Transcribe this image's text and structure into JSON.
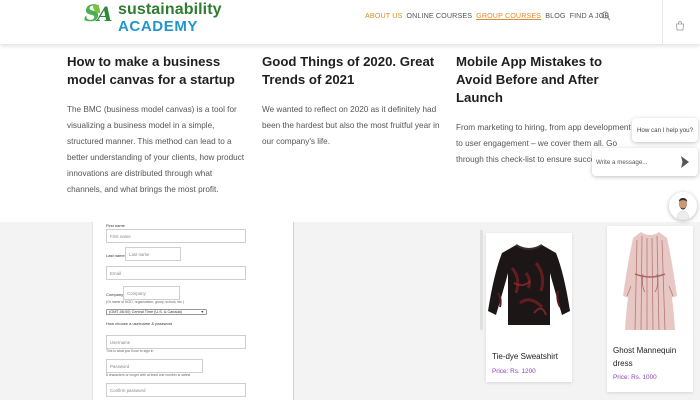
{
  "brand": {
    "logo_line1": "sustainability",
    "logo_line2": "ACADEMY",
    "green": "#2e7d32",
    "blue": "#2196c9",
    "accent_orange": "#e08a2c"
  },
  "nav": {
    "items": [
      "ABOUT US",
      "ONLINE COURSES",
      "GROUP COURSES",
      "BLOG",
      "FIND A JOB"
    ],
    "active_index": 0,
    "search_icon": "search-icon",
    "cart_icon": "cart-icon"
  },
  "posts": [
    {
      "title": "How to make a business model canvas for a startup",
      "excerpt": "The BMC (business model canvas) is a tool for visualizing a business model in a simple, structured manner. This method can lead to a better understanding of your clients, how product innovations are distributed through what channels, and what brings the most profit."
    },
    {
      "title": "Good Things of 2020. Great Trends of 2021",
      "excerpt": "We wanted to reflect on 2020 as it definitely had been the hardest but also the most fruitful year in our company's life."
    },
    {
      "title": "Mobile App Mistakes to Avoid Before and After Launch",
      "excerpt": "From marketing to hiring, from app development to user engagement – we cover them all. Go through this check-list to ensure success!"
    }
  ],
  "chat": {
    "help_text": "How can I help you?",
    "input_placeholder": "Write a message...",
    "send_icon": "send-icon"
  },
  "form": {
    "first_name_label": "First name",
    "first_name_placeholder": "First name",
    "last_name_label": "Last name",
    "last_name_placeholder": "Last name",
    "email_placeholder": "Email",
    "company_label": "Company",
    "company_placeholder": "Company",
    "company_hint": "(Or name of NGO, organization, group, school, etc.)",
    "timezone_value": "(GMT-06:00) Central Time (U.S. & Canada)",
    "credentials_heading": "How choose a username & password",
    "username_placeholder": "Username",
    "username_hint": "This is what you'll use to sign in",
    "password_placeholder": "Password",
    "password_hint": "8 characters or longer with at least one number is safest",
    "confirm_password_placeholder": "Confirm password"
  },
  "products": [
    {
      "name": "Tie-dye Sweatshirt",
      "price": "Price: Rs. 1200"
    },
    {
      "name": "Ghost Mannequin dress",
      "price": "Price: Rs. 1000"
    }
  ]
}
